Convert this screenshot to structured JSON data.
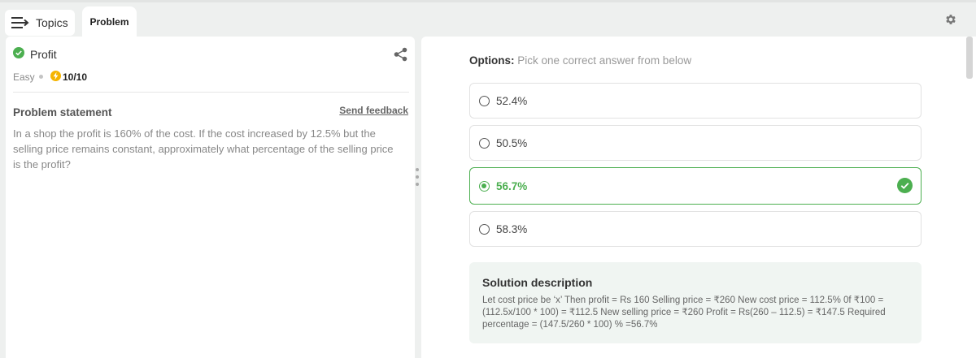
{
  "topbar": {
    "topics_label": "Topics",
    "problem_tab_label": "Problem"
  },
  "problem": {
    "title": "Profit",
    "difficulty": "Easy",
    "score": "10/10",
    "statement_heading": "Problem statement",
    "feedback_link": "Send feedback",
    "statement": "In a shop the profit is 160% of the cost. If the cost increased by 12.5% but the selling price remains constant, approximately what percentage of the selling price is the profit?"
  },
  "options": {
    "heading_bold": "Options:",
    "heading_rest": " Pick one correct answer from below",
    "items": [
      {
        "label": "52.4%"
      },
      {
        "label": "50.5%"
      },
      {
        "label": "56.7%"
      },
      {
        "label": "58.3%"
      }
    ],
    "selected_index": 2
  },
  "solution": {
    "heading": "Solution description",
    "text": "Let cost price be ‘x’ Then profit = Rs 160 Selling price = ₹260 New cost price = 112.5% 0f ₹100 = (112.5x/100 * 100) = ₹112.5 New selling price = ₹260 Profit = Rs(260 – 112.5) = ₹147.5 Required percentage = (147.5/260 * 100) % =56.7%"
  },
  "colors": {
    "correct_green": "#4caf50",
    "score_bolt": "#f5b400"
  },
  "icons": [
    "menu-arrow-icon",
    "gear-icon",
    "check-circle-icon",
    "share-icon",
    "bolt-icon",
    "radio-icon",
    "correct-check-icon"
  ]
}
